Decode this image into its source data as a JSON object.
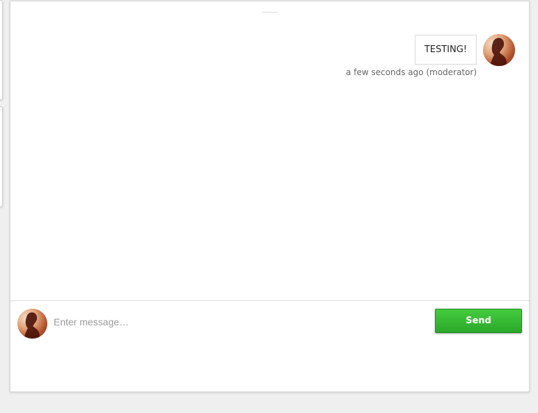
{
  "messages": [
    {
      "text": "TESTING!",
      "meta": "a few seconds ago (moderator)",
      "avatar_icon": "user-avatar-photo"
    }
  ],
  "composer": {
    "placeholder": "Enter message…",
    "value": "",
    "send_label": "Send",
    "avatar_icon": "user-avatar-photo"
  },
  "colors": {
    "send_button": "#33b533",
    "background": "#efefef",
    "panel": "#ffffff"
  }
}
